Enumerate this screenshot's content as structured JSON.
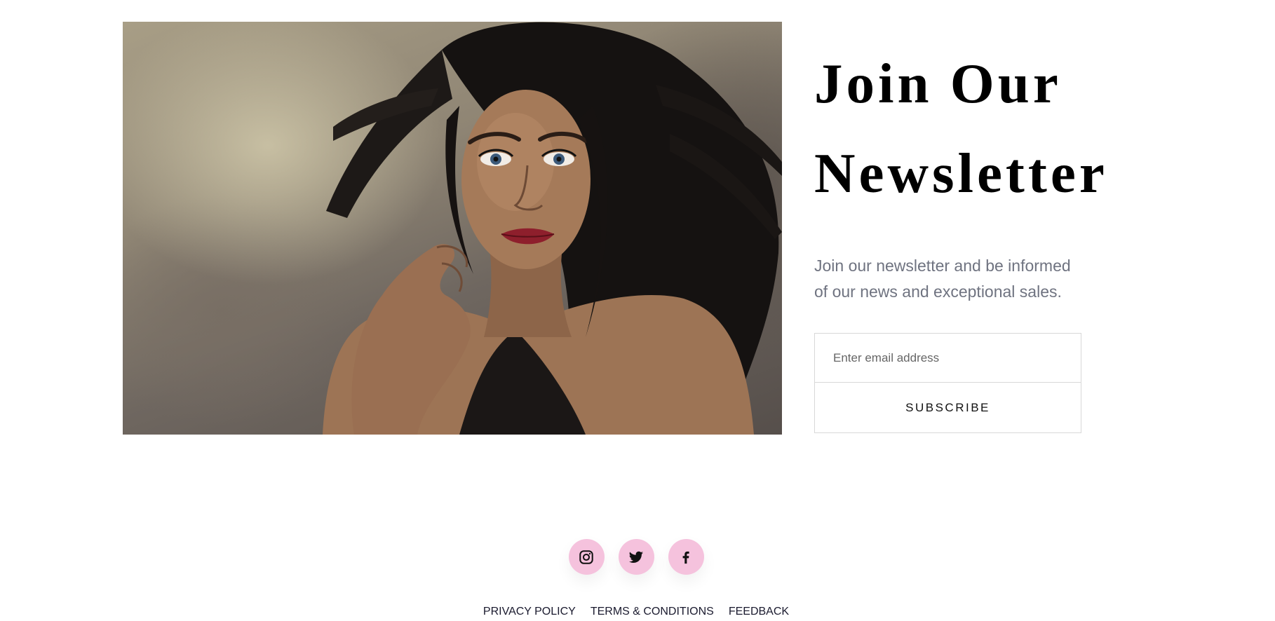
{
  "hero_image": {
    "subject": "portrait-photo"
  },
  "newsletter": {
    "title_line1": "Join Our",
    "title_line2": "Newsletter",
    "description": "Join our newsletter and be informed of our news and exceptional sales.",
    "email_placeholder": "Enter email address",
    "email_value": "",
    "subscribe_label": "SUBSCRIBE"
  },
  "footer": {
    "social": [
      {
        "icon": "instagram-icon"
      },
      {
        "icon": "twitter-icon"
      },
      {
        "icon": "facebook-icon"
      }
    ],
    "links": {
      "privacy": "PRIVACY POLICY",
      "terms": "TERMS & CONDITIONS",
      "feedback": "FEEDBACK"
    }
  },
  "colors": {
    "social_bg": "#f5c2dd",
    "description_text": "#6f7380",
    "border": "#d8d8d8"
  }
}
